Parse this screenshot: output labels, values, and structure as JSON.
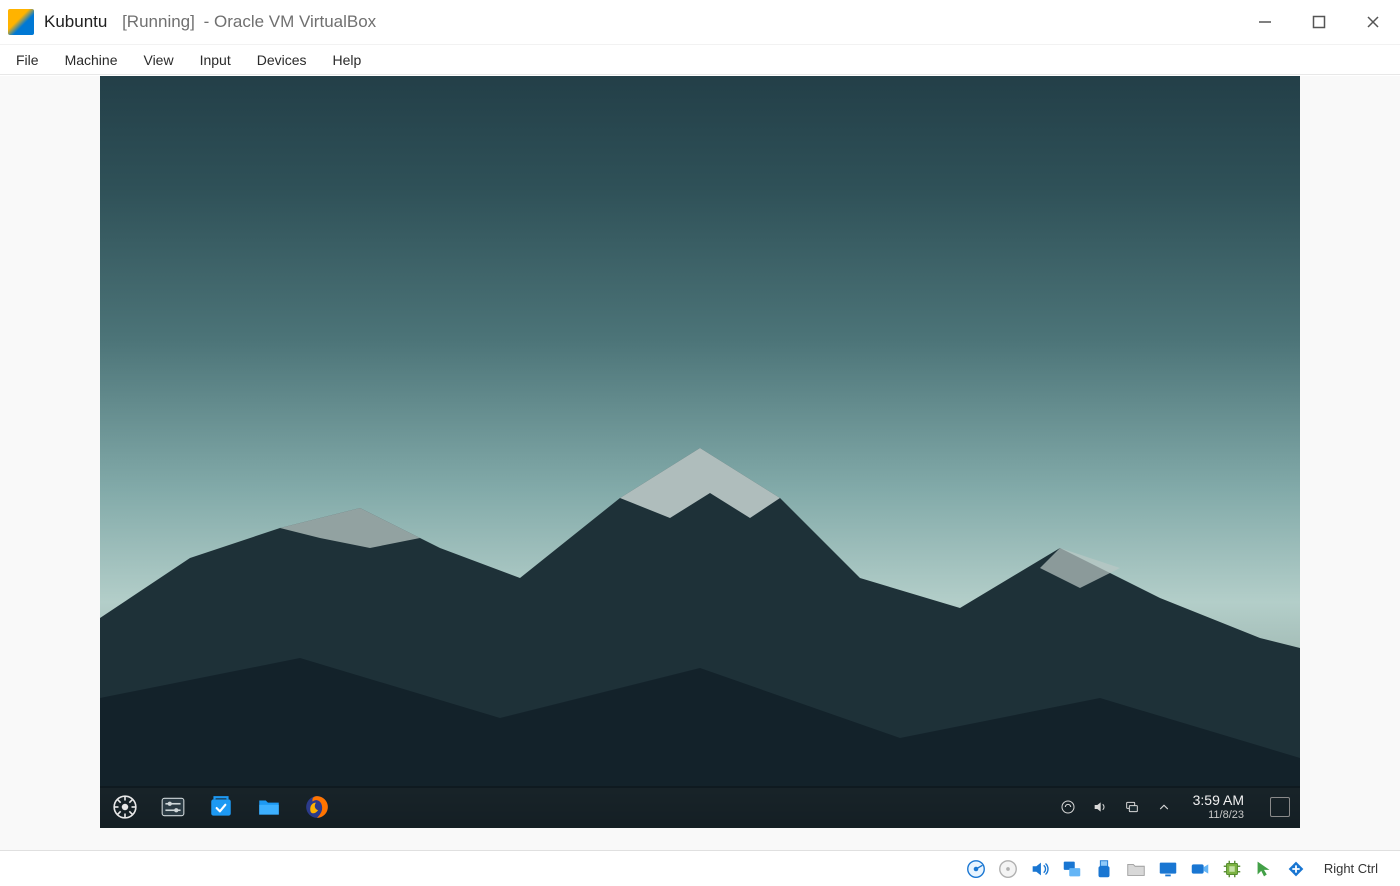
{
  "host_window": {
    "vm_name": "Kubuntu",
    "status": "[Running]",
    "app_suffix": "- Oracle VM VirtualBox"
  },
  "vb_menu": {
    "items": [
      "File",
      "Machine",
      "View",
      "Input",
      "Devices",
      "Help"
    ]
  },
  "kde": {
    "clock": {
      "time": "3:59 AM",
      "date": "11/8/23"
    },
    "launchers": {
      "start": "application-launcher",
      "settings": "system-settings",
      "discover": "discover-software-center",
      "files": "dolphin-file-manager",
      "firefox": "firefox-browser"
    },
    "tray": {
      "keyboard": "keyboard-layout",
      "volume": "audio-volume",
      "network": "network-status",
      "expand": "tray-expand"
    }
  },
  "vb_status": {
    "icons": [
      "hard-disk",
      "optical-drive",
      "audio",
      "network",
      "usb",
      "shared-folders",
      "display",
      "recording",
      "cpu",
      "mouse-integration",
      "guest-additions"
    ],
    "host_key": "Right Ctrl"
  },
  "colors": {
    "kde_accent": "#1d99f3",
    "firefox": "#ff7400"
  }
}
